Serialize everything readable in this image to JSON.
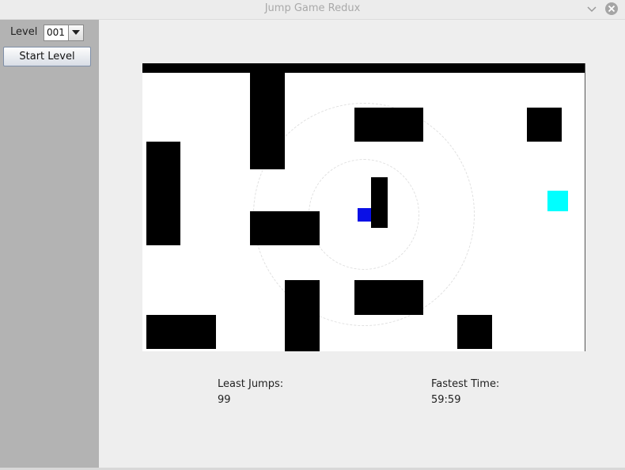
{
  "window": {
    "title": "Jump Game Redux"
  },
  "controls": {
    "level_label": "Level",
    "level_value": "001",
    "start_label": "Start Level"
  },
  "stats": {
    "least_jumps_label": "Least Jumps:",
    "least_jumps_value": "99",
    "fastest_time_label": "Fastest Time:",
    "fastest_time_value": "59:59"
  },
  "colors": {
    "player": "#0a10e6",
    "goal": "#00ffff",
    "wall": "#000000",
    "sidebar": "#b3b3b3"
  },
  "icons": [
    "chevron-down-icon",
    "close-icon",
    "dropdown-arrow-icon"
  ]
}
